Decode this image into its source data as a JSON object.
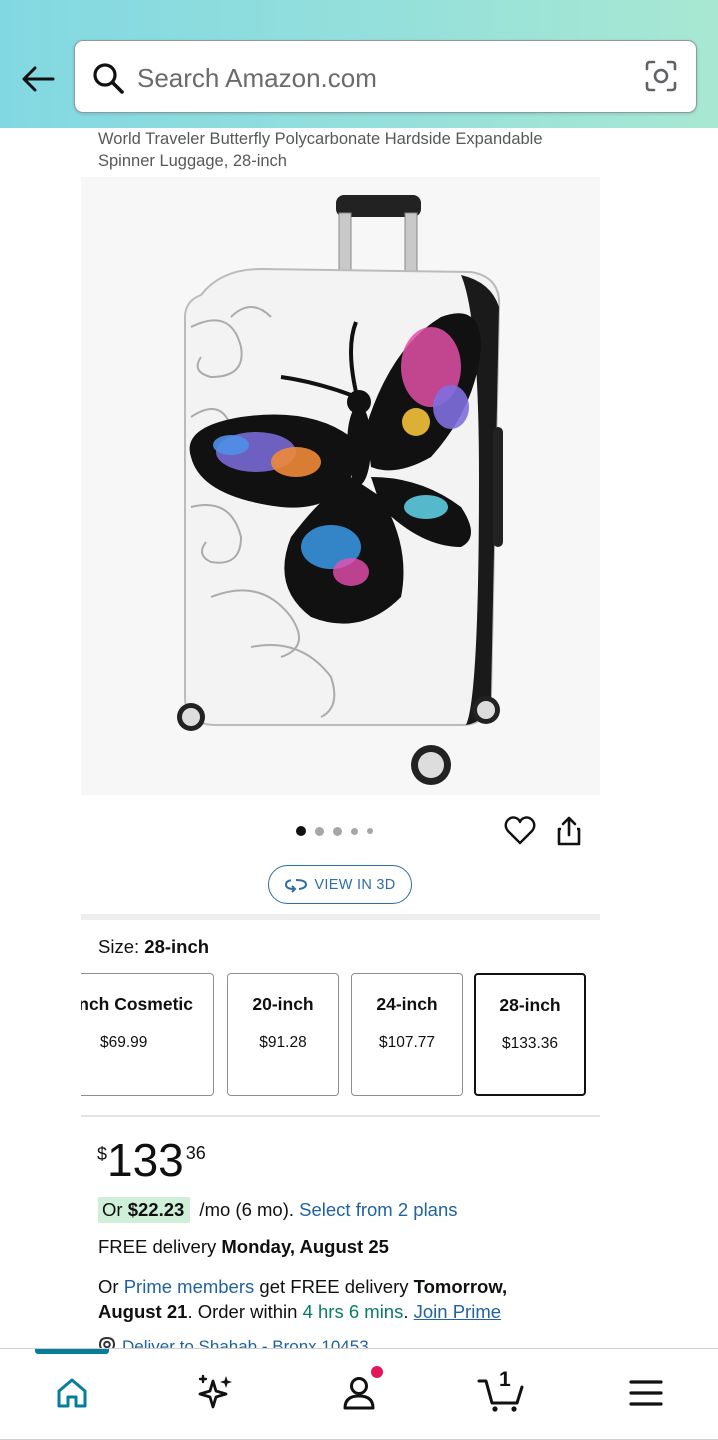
{
  "search": {
    "placeholder": "Search Amazon.com"
  },
  "product": {
    "title": "World Traveler Butterfly Polycarbonate Hardside Expandable Spinner Luggage, 28-inch",
    "image_alt": "White hardside spinner suitcase with a colorful butterfly print",
    "carousel_dots": 5,
    "view_3d_label": "VIEW IN 3D"
  },
  "size": {
    "label": "Size: ",
    "selected": "28-inch",
    "options": [
      {
        "name": "nch Cosmetic",
        "price": "$69.99"
      },
      {
        "name": "20-inch",
        "price": "$91.28"
      },
      {
        "name": "24-inch",
        "price": "$107.77"
      },
      {
        "name": "28-inch",
        "price": "$133.36"
      }
    ]
  },
  "price": {
    "symbol": "$",
    "whole": "133",
    "fraction": "36"
  },
  "installment": {
    "prefix": "Or ",
    "amount": "$22.23",
    "terms": " /mo (6 mo). ",
    "plans_link": "Select from 2 plans"
  },
  "delivery": {
    "free_text": "FREE delivery ",
    "date": "Monday, August 25"
  },
  "prime": {
    "prefix": "Or ",
    "members_link": "Prime members",
    "mid": " get FREE delivery ",
    "fast_date": "Tomorrow, August 21",
    "order_within": ". Order within ",
    "countdown": "4 hrs 6 mins",
    "dot": ". ",
    "join_link": "Join Prime"
  },
  "deliver_to": "Deliver to Shahab - Bronx 10453",
  "cart": {
    "count": "1"
  },
  "colors": {
    "link": "#2162a1",
    "teal": "#067d62",
    "header_gradient_start": "#82d8e2",
    "header_gradient_end": "#a8e8d2",
    "notification_dot": "#e3165b"
  },
  "icons": {
    "back": "back-arrow-icon",
    "search": "search-icon",
    "camera": "camera-lens-icon",
    "wishlist": "heart-icon",
    "share": "share-icon",
    "view3d": "rotate-3d-icon",
    "location": "location-pin-icon",
    "home": "home-icon",
    "ai": "sparkle-icon",
    "account": "person-icon",
    "cart": "cart-icon",
    "menu": "hamburger-menu-icon"
  }
}
